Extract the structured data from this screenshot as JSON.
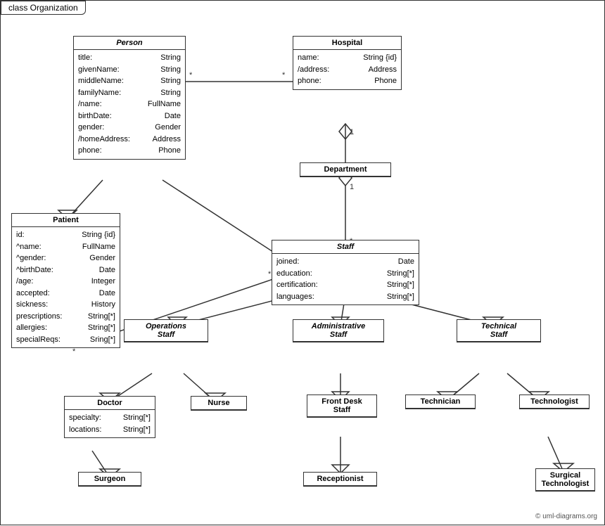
{
  "title": "class Organization",
  "copyright": "© uml-diagrams.org",
  "classes": {
    "person": {
      "name": "Person",
      "italic": true,
      "attrs": [
        {
          "name": "title:",
          "type": "String"
        },
        {
          "name": "givenName:",
          "type": "String"
        },
        {
          "name": "middleName:",
          "type": "String"
        },
        {
          "name": "familyName:",
          "type": "String"
        },
        {
          "name": "/name:",
          "type": "FullName"
        },
        {
          "name": "birthDate:",
          "type": "Date"
        },
        {
          "name": "gender:",
          "type": "Gender"
        },
        {
          "name": "/homeAddress:",
          "type": "Address"
        },
        {
          "name": "phone:",
          "type": "Phone"
        }
      ]
    },
    "hospital": {
      "name": "Hospital",
      "italic": false,
      "attrs": [
        {
          "name": "name:",
          "type": "String {id}"
        },
        {
          "name": "/address:",
          "type": "Address"
        },
        {
          "name": "phone:",
          "type": "Phone"
        }
      ]
    },
    "patient": {
      "name": "Patient",
      "italic": false,
      "attrs": [
        {
          "name": "id:",
          "type": "String {id}"
        },
        {
          "name": "^name:",
          "type": "FullName"
        },
        {
          "name": "^gender:",
          "type": "Gender"
        },
        {
          "name": "^birthDate:",
          "type": "Date"
        },
        {
          "name": "/age:",
          "type": "Integer"
        },
        {
          "name": "accepted:",
          "type": "Date"
        },
        {
          "name": "sickness:",
          "type": "History"
        },
        {
          "name": "prescriptions:",
          "type": "String[*]"
        },
        {
          "name": "allergies:",
          "type": "String[*]"
        },
        {
          "name": "specialReqs:",
          "type": "Sring[*]"
        }
      ]
    },
    "department": {
      "name": "Department",
      "italic": false,
      "attrs": []
    },
    "staff": {
      "name": "Staff",
      "italic": true,
      "attrs": [
        {
          "name": "joined:",
          "type": "Date"
        },
        {
          "name": "education:",
          "type": "String[*]"
        },
        {
          "name": "certification:",
          "type": "String[*]"
        },
        {
          "name": "languages:",
          "type": "String[*]"
        }
      ]
    },
    "operations_staff": {
      "name": "Operations\nStaff",
      "italic": true,
      "attrs": []
    },
    "administrative_staff": {
      "name": "Administrative\nStaff",
      "italic": true,
      "attrs": []
    },
    "technical_staff": {
      "name": "Technical\nStaff",
      "italic": true,
      "attrs": []
    },
    "doctor": {
      "name": "Doctor",
      "italic": false,
      "attrs": [
        {
          "name": "specialty:",
          "type": "String[*]"
        },
        {
          "name": "locations:",
          "type": "String[*]"
        }
      ]
    },
    "nurse": {
      "name": "Nurse",
      "italic": false,
      "attrs": []
    },
    "front_desk_staff": {
      "name": "Front Desk\nStaff",
      "italic": false,
      "attrs": []
    },
    "technician": {
      "name": "Technician",
      "italic": false,
      "attrs": []
    },
    "technologist": {
      "name": "Technologist",
      "italic": false,
      "attrs": []
    },
    "surgeon": {
      "name": "Surgeon",
      "italic": false,
      "attrs": []
    },
    "receptionist": {
      "name": "Receptionist",
      "italic": false,
      "attrs": []
    },
    "surgical_technologist": {
      "name": "Surgical\nTechnologist",
      "italic": false,
      "attrs": []
    }
  }
}
